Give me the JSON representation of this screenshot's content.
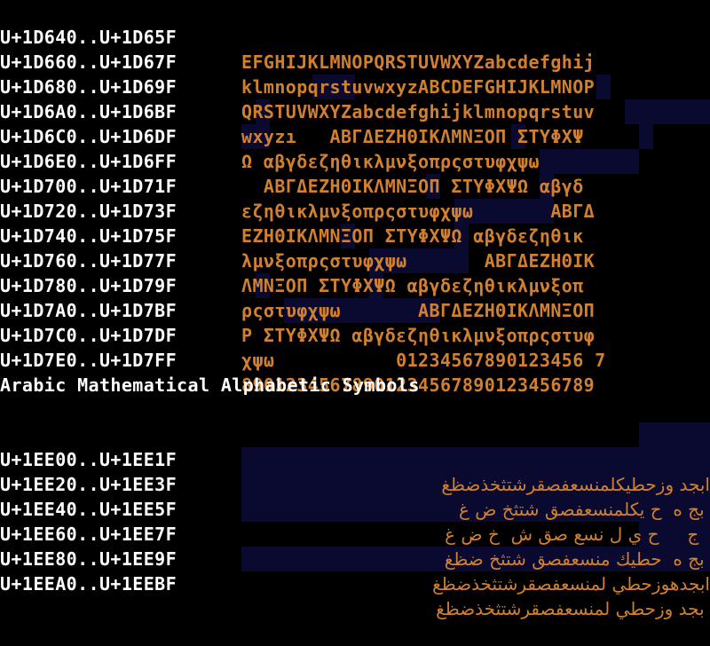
{
  "math_alnum": {
    "rows": [
      {
        "range": "U+1D640..U+1D65F",
        "glyphs": "EFGHIJKLMNOPQRSTUVWXYZabcdefghij"
      },
      {
        "range": "U+1D660..U+1D67F",
        "glyphs": "klmnopqrstuvwxyzABCDEFGHIJKLMNOP"
      },
      {
        "range": "U+1D680..U+1D69F",
        "glyphs": "QRSTUVWXYZabcdefghijklmnopqrstuv"
      },
      {
        "range": "U+1D6A0..U+1D6BF",
        "glyphs": "wxyzı   ΑΒΓΔΕΖΗΘΙΚΛΜΝΞΟΠ ΣΤΥΦΧΨ"
      },
      {
        "range": "U+1D6C0..U+1D6DF",
        "glyphs": "Ω αβγδεζηθικλμνξοπρςστυφχψω"
      },
      {
        "range": "U+1D6E0..U+1D6FF",
        "glyphs": "  ΑΒΓΔΕΖΗΘΙΚΛΜΝΞΟΠ ΣΤΥΦΧΨΩ αβγδ"
      },
      {
        "range": "U+1D700..U+1D71F",
        "glyphs": "εζηθικλμνξοπρςστυφχψω       ΑΒΓΔ"
      },
      {
        "range": "U+1D720..U+1D73F",
        "glyphs": "ΕΖΗΘΙΚΛΜΝΞΟΠ ΣΤΥΦΧΨΩ αβγδεζηθικ"
      },
      {
        "range": "U+1D740..U+1D75F",
        "glyphs": "λμνξοπρςστυφχψω       ΑΒΓΔΕΖΗΘΙΚ"
      },
      {
        "range": "U+1D760..U+1D77F",
        "glyphs": "ΛΜΝΞΟΠ ΣΤΥΦΧΨΩ αβγδεζηθικλμνξοπ"
      },
      {
        "range": "U+1D780..U+1D79F",
        "glyphs": "ρςστυφχψω       ΑΒΓΔΕΖΗΘΙΚΛΜΝΞΟΠ"
      },
      {
        "range": "U+1D7A0..U+1D7BF",
        "glyphs": "Ρ ΣΤΥΦΧΨΩ αβγδεζηθικλμνξοπρςστυφ"
      },
      {
        "range": "U+1D7C0..U+1D7DF",
        "glyphs": "χψω           01234567890123456 7"
      },
      {
        "range": "U+1D7E0..U+1D7FF",
        "glyphs": "89012345678901234567890123456789"
      }
    ]
  },
  "arabic_section": {
    "title": "Arabic Mathematical Alphabetic Symbols",
    "rows": [
      {
        "range": "U+1EE00..U+1EE1F",
        "glyphs": "ابجد وزحطيكلمنسعفصقرشتثخذضظغ"
      },
      {
        "range": "U+1EE20..U+1EE3F",
        "glyphs": " بج ه  ح يكلمنسعفصق شتثخ ض غ"
      },
      {
        "range": "U+1EE40..U+1EE5F",
        "glyphs": "  ج     ح ي ل نسع صق ش  خ ض غ"
      },
      {
        "range": "U+1EE60..U+1EE7F",
        "glyphs": " بج ه  حطيك منسعفصق شتثخ ضظغ"
      },
      {
        "range": "U+1EE80..U+1EE9F",
        "glyphs": "ابجدهوزحطي لمنسعفصقرشتثخذضظغ"
      },
      {
        "range": "U+1EEA0..U+1EEBF",
        "glyphs": " بجد وزحطي لمنسعفصقرشتثخذضظغ"
      }
    ]
  },
  "colors": {
    "background": "#000000",
    "label": "#ffffff",
    "glyph": "#d08030",
    "missing_cell": "#0a0a30"
  }
}
